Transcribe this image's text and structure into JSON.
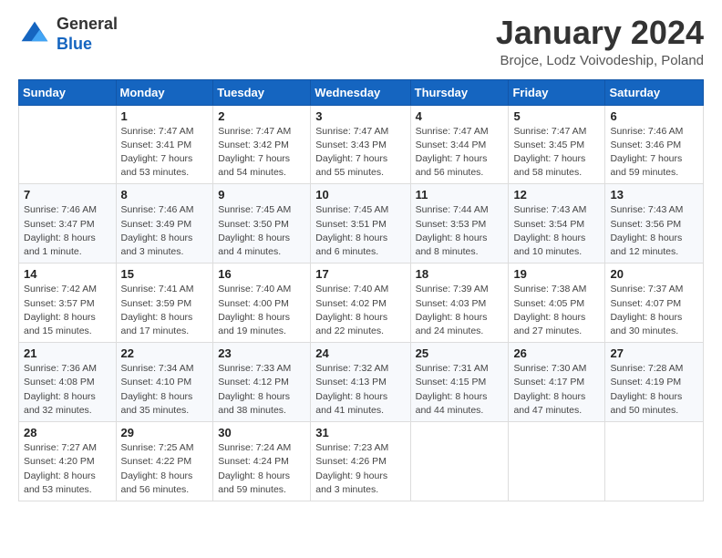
{
  "header": {
    "logo_line1": "General",
    "logo_line2": "Blue",
    "month": "January 2024",
    "location": "Brojce, Lodz Voivodeship, Poland"
  },
  "weekdays": [
    "Sunday",
    "Monday",
    "Tuesday",
    "Wednesday",
    "Thursday",
    "Friday",
    "Saturday"
  ],
  "weeks": [
    [
      {
        "day": "",
        "info": ""
      },
      {
        "day": "1",
        "info": "Sunrise: 7:47 AM\nSunset: 3:41 PM\nDaylight: 7 hours\nand 53 minutes."
      },
      {
        "day": "2",
        "info": "Sunrise: 7:47 AM\nSunset: 3:42 PM\nDaylight: 7 hours\nand 54 minutes."
      },
      {
        "day": "3",
        "info": "Sunrise: 7:47 AM\nSunset: 3:43 PM\nDaylight: 7 hours\nand 55 minutes."
      },
      {
        "day": "4",
        "info": "Sunrise: 7:47 AM\nSunset: 3:44 PM\nDaylight: 7 hours\nand 56 minutes."
      },
      {
        "day": "5",
        "info": "Sunrise: 7:47 AM\nSunset: 3:45 PM\nDaylight: 7 hours\nand 58 minutes."
      },
      {
        "day": "6",
        "info": "Sunrise: 7:46 AM\nSunset: 3:46 PM\nDaylight: 7 hours\nand 59 minutes."
      }
    ],
    [
      {
        "day": "7",
        "info": "Sunrise: 7:46 AM\nSunset: 3:47 PM\nDaylight: 8 hours\nand 1 minute."
      },
      {
        "day": "8",
        "info": "Sunrise: 7:46 AM\nSunset: 3:49 PM\nDaylight: 8 hours\nand 3 minutes."
      },
      {
        "day": "9",
        "info": "Sunrise: 7:45 AM\nSunset: 3:50 PM\nDaylight: 8 hours\nand 4 minutes."
      },
      {
        "day": "10",
        "info": "Sunrise: 7:45 AM\nSunset: 3:51 PM\nDaylight: 8 hours\nand 6 minutes."
      },
      {
        "day": "11",
        "info": "Sunrise: 7:44 AM\nSunset: 3:53 PM\nDaylight: 8 hours\nand 8 minutes."
      },
      {
        "day": "12",
        "info": "Sunrise: 7:43 AM\nSunset: 3:54 PM\nDaylight: 8 hours\nand 10 minutes."
      },
      {
        "day": "13",
        "info": "Sunrise: 7:43 AM\nSunset: 3:56 PM\nDaylight: 8 hours\nand 12 minutes."
      }
    ],
    [
      {
        "day": "14",
        "info": "Sunrise: 7:42 AM\nSunset: 3:57 PM\nDaylight: 8 hours\nand 15 minutes."
      },
      {
        "day": "15",
        "info": "Sunrise: 7:41 AM\nSunset: 3:59 PM\nDaylight: 8 hours\nand 17 minutes."
      },
      {
        "day": "16",
        "info": "Sunrise: 7:40 AM\nSunset: 4:00 PM\nDaylight: 8 hours\nand 19 minutes."
      },
      {
        "day": "17",
        "info": "Sunrise: 7:40 AM\nSunset: 4:02 PM\nDaylight: 8 hours\nand 22 minutes."
      },
      {
        "day": "18",
        "info": "Sunrise: 7:39 AM\nSunset: 4:03 PM\nDaylight: 8 hours\nand 24 minutes."
      },
      {
        "day": "19",
        "info": "Sunrise: 7:38 AM\nSunset: 4:05 PM\nDaylight: 8 hours\nand 27 minutes."
      },
      {
        "day": "20",
        "info": "Sunrise: 7:37 AM\nSunset: 4:07 PM\nDaylight: 8 hours\nand 30 minutes."
      }
    ],
    [
      {
        "day": "21",
        "info": "Sunrise: 7:36 AM\nSunset: 4:08 PM\nDaylight: 8 hours\nand 32 minutes."
      },
      {
        "day": "22",
        "info": "Sunrise: 7:34 AM\nSunset: 4:10 PM\nDaylight: 8 hours\nand 35 minutes."
      },
      {
        "day": "23",
        "info": "Sunrise: 7:33 AM\nSunset: 4:12 PM\nDaylight: 8 hours\nand 38 minutes."
      },
      {
        "day": "24",
        "info": "Sunrise: 7:32 AM\nSunset: 4:13 PM\nDaylight: 8 hours\nand 41 minutes."
      },
      {
        "day": "25",
        "info": "Sunrise: 7:31 AM\nSunset: 4:15 PM\nDaylight: 8 hours\nand 44 minutes."
      },
      {
        "day": "26",
        "info": "Sunrise: 7:30 AM\nSunset: 4:17 PM\nDaylight: 8 hours\nand 47 minutes."
      },
      {
        "day": "27",
        "info": "Sunrise: 7:28 AM\nSunset: 4:19 PM\nDaylight: 8 hours\nand 50 minutes."
      }
    ],
    [
      {
        "day": "28",
        "info": "Sunrise: 7:27 AM\nSunset: 4:20 PM\nDaylight: 8 hours\nand 53 minutes."
      },
      {
        "day": "29",
        "info": "Sunrise: 7:25 AM\nSunset: 4:22 PM\nDaylight: 8 hours\nand 56 minutes."
      },
      {
        "day": "30",
        "info": "Sunrise: 7:24 AM\nSunset: 4:24 PM\nDaylight: 8 hours\nand 59 minutes."
      },
      {
        "day": "31",
        "info": "Sunrise: 7:23 AM\nSunset: 4:26 PM\nDaylight: 9 hours\nand 3 minutes."
      },
      {
        "day": "",
        "info": ""
      },
      {
        "day": "",
        "info": ""
      },
      {
        "day": "",
        "info": ""
      }
    ]
  ]
}
